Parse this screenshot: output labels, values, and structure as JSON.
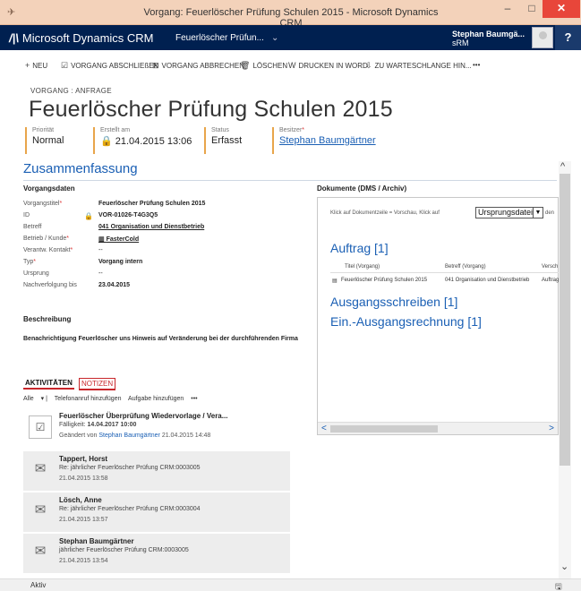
{
  "window": {
    "title": "Vorgang: Feuerlöscher Prüfung Schulen 2015 - Microsoft Dynamics CRM",
    "min": "–",
    "max": "□",
    "close": "✕"
  },
  "nav": {
    "app_name": "Microsoft Dynamics CRM",
    "record": "Feuerlöscher Prüfun...",
    "record_chevron": "⌄",
    "user": "Stephan Baumgä...",
    "org": "sRM",
    "help": "?"
  },
  "commands": [
    {
      "icon": "+",
      "label": "NEU"
    },
    {
      "icon": "☑",
      "label": "VORGANG ABSCHLIEßEN"
    },
    {
      "icon": "⊠",
      "label": "VORGANG ABBRECHEN"
    },
    {
      "icon": "🗑",
      "label": "LÖSCHEN"
    },
    {
      "icon": "W",
      "label": "DRUCKEN IN WORD"
    },
    {
      "icon": "⇩",
      "label": "ZU WARTESCHLANGE HIN..."
    },
    {
      "icon": "",
      "label": "•••"
    }
  ],
  "header": {
    "crumb": "VORGANG : ANFRAGE",
    "title": "Feuerlöscher Prüfung Schulen 2015",
    "fields": [
      {
        "label": "Priorität",
        "value": "Normal"
      },
      {
        "label": "Erstellt am",
        "value": "21.04.2015  13:06"
      },
      {
        "label": "Status",
        "value": "Erfasst"
      },
      {
        "label": "Besitzer",
        "value": "Stephan Baumgärtner"
      }
    ]
  },
  "summary": {
    "title": "Zusammenfassung",
    "data_heading": "Vorgangsdaten",
    "fields": [
      {
        "label": "Vorgangstitel",
        "value": "Feuerlöscher Prüfung Schulen 2015"
      },
      {
        "label": "ID",
        "value": "VOR-01026-T4G3Q5"
      },
      {
        "label": "Betreff",
        "value": "041 Organisation und Dienstbetrieb"
      },
      {
        "label": "Betrieb / Kunde",
        "value": "FasterCold"
      },
      {
        "label": "Verantw. Kontakt",
        "value": "--"
      },
      {
        "label": "Typ",
        "value": "Vorgang intern"
      },
      {
        "label": "Ursprung",
        "value": "--"
      },
      {
        "label": "Nachverfolgung bis",
        "value": "23.04.2015"
      }
    ],
    "desc_heading": "Beschreibung",
    "description": "Benachrichtigung Feuerlöscher uns Hinweis auf Veränderung bei der durchführenden Firma"
  },
  "documents": {
    "heading": "Dokumente (DMS / Archiv)",
    "hint": "Klick auf Dokumentzeile = Vorschau, Klick auf",
    "hint_overlap": "Ursprungsdatei",
    "hint_tail": "den",
    "select_value": "Ursprungsdatei",
    "groups": [
      "Auftrag [1]",
      "Ausgangsschreiben [1]",
      "Ein.-Ausgangsrechnung [1]"
    ],
    "columns": [
      "Titel (Vorgang)",
      "Betreff (Vorgang)",
      "Versch"
    ],
    "rows": [
      {
        "title": "Feuerlöscher Prüfung Schulen 2015",
        "subject": "041 Organisation und Dienstbetrieb",
        "type": "Auftrag"
      }
    ]
  },
  "activities": {
    "tab_active": "AKTIVITÄTEN",
    "tab_other": "NOTIZEN",
    "filter": "Alle",
    "actions": [
      "Telefonanruf hinzufügen",
      "Aufgabe hinzufügen",
      "•••"
    ],
    "items": [
      {
        "title": "Feuerlöscher Überprüfung Wiedervorlage / Vera...",
        "line2_label": "Fälligkeit:",
        "line2_value": "14.04.2017 10:00",
        "line3_prefix": "Geändert von",
        "line3_user": "Stephan Baumgärtner",
        "line3_date": "21.04.2015 14:48"
      },
      {
        "title": "Tappert, Horst",
        "line2": "Re: jährlicher Feuerlöscher Prüfung CRM:0003005",
        "line3": "21.04.2015 13:58"
      },
      {
        "title": "Lösch, Anne",
        "line2": "Re: jährlicher Feuerlöscher Prüfung CRM:0003004",
        "line3": "21.04.2015 13:57"
      },
      {
        "title": "Stephan Baumgärtner",
        "line2": "jährlicher Feuerlöscher Prüfung CRM:0003005",
        "line3": "21.04.2015 13:54"
      }
    ]
  },
  "status": {
    "text": "Aktiv",
    "save_icon": "🖫"
  },
  "colors": {
    "nav": "#002050",
    "accent": "#1a5fb4",
    "title_bar": "#f3d2ba",
    "required": "#dd3333",
    "tab_underline": "#c8262b"
  }
}
